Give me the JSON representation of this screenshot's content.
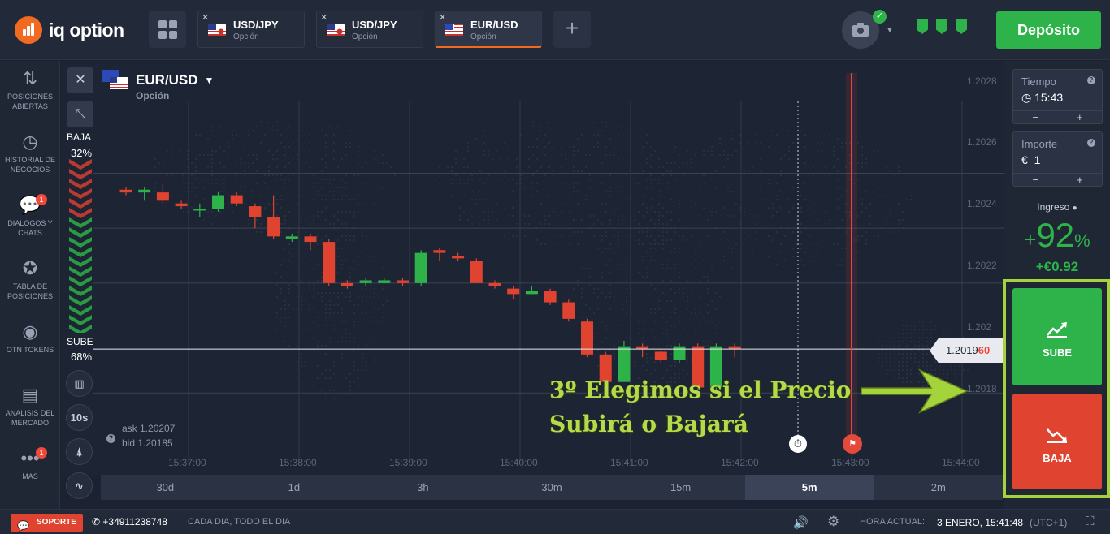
{
  "header": {
    "logo_text": "iq option",
    "tabs": [
      {
        "pair": "USD/JPY",
        "type": "Opción",
        "active": false
      },
      {
        "pair": "USD/JPY",
        "type": "Opción",
        "active": false
      },
      {
        "pair": "EUR/USD",
        "type": "Opción",
        "active": true
      }
    ],
    "add_tab": "+",
    "deposit_label": "Depósito"
  },
  "sidebar": {
    "items": [
      {
        "label": "POSICIONES ABIERTAS",
        "icon": "arrows-updown-icon"
      },
      {
        "label": "HISTORIAL DE NEGOCIOS",
        "icon": "history-icon"
      },
      {
        "label": "DIALOGOS Y CHATS",
        "icon": "chat-icon",
        "badge": "1"
      },
      {
        "label": "TABLA DE POSICIONES",
        "icon": "medal-icon"
      },
      {
        "label": "OTN TOKENS",
        "icon": "token-icon"
      },
      {
        "label": "ANALISIS DEL MERCADO",
        "icon": "news-icon"
      },
      {
        "label": "MAS",
        "icon": "more-icon",
        "badge": "1"
      }
    ]
  },
  "chart": {
    "pair": "EUR/USD",
    "type": "Opción",
    "down_label": "BAJA",
    "down_pct": "32%",
    "up_label": "SUBE",
    "up_pct": "68%",
    "ask": "ask 1.20207",
    "bid": "bid 1.20185",
    "interval_btn": "10s",
    "current_price_main": "1.2019",
    "current_price_tail": "60",
    "annotation_line1": "3º Elegimos si el Precio",
    "annotation_line2": "Subirá o Bajará"
  },
  "chart_data": {
    "type": "candlestick",
    "y_ticks": [
      "1.2026",
      "1.2024",
      "1.2022",
      "1.202",
      "1.2018"
    ],
    "x_ticks": [
      "15:37:00",
      "15:38:00",
      "15:39:00",
      "15:40:00",
      "15:41:00",
      "15:42:00",
      "15:43:00",
      "15:44:00"
    ],
    "ylim": [
      1.20165,
      1.20295
    ],
    "current_price": 1.20196,
    "expiry_time": "15:43:00",
    "candles": [
      {
        "o": 1.20254,
        "c": 1.20253,
        "h": 1.20255,
        "l": 1.20252
      },
      {
        "o": 1.20253,
        "c": 1.20254,
        "h": 1.20255,
        "l": 1.2025
      },
      {
        "o": 1.20253,
        "c": 1.2025,
        "h": 1.20256,
        "l": 1.20249
      },
      {
        "o": 1.20249,
        "c": 1.20248,
        "h": 1.2025,
        "l": 1.20247
      },
      {
        "o": 1.20247,
        "c": 1.20247,
        "h": 1.20249,
        "l": 1.20244
      },
      {
        "o": 1.20247,
        "c": 1.20252,
        "h": 1.20253,
        "l": 1.20246
      },
      {
        "o": 1.20252,
        "c": 1.20249,
        "h": 1.20253,
        "l": 1.20248
      },
      {
        "o": 1.20248,
        "c": 1.20244,
        "h": 1.20249,
        "l": 1.2024
      },
      {
        "o": 1.20244,
        "c": 1.20237,
        "h": 1.20252,
        "l": 1.20236
      },
      {
        "o": 1.20236,
        "c": 1.20237,
        "h": 1.20238,
        "l": 1.20235
      },
      {
        "o": 1.20237,
        "c": 1.20235,
        "h": 1.20238,
        "l": 1.20232
      },
      {
        "o": 1.20235,
        "c": 1.2022,
        "h": 1.20236,
        "l": 1.20219
      },
      {
        "o": 1.2022,
        "c": 1.20219,
        "h": 1.20221,
        "l": 1.20218
      },
      {
        "o": 1.2022,
        "c": 1.20221,
        "h": 1.20222,
        "l": 1.20219
      },
      {
        "o": 1.2022,
        "c": 1.20221,
        "h": 1.20222,
        "l": 1.2022
      },
      {
        "o": 1.20221,
        "c": 1.2022,
        "h": 1.20222,
        "l": 1.20219
      },
      {
        "o": 1.2022,
        "c": 1.20231,
        "h": 1.20232,
        "l": 1.20219
      },
      {
        "o": 1.20232,
        "c": 1.20231,
        "h": 1.20233,
        "l": 1.20228
      },
      {
        "o": 1.2023,
        "c": 1.20229,
        "h": 1.20231,
        "l": 1.20228
      },
      {
        "o": 1.20228,
        "c": 1.2022,
        "h": 1.20229,
        "l": 1.2022
      },
      {
        "o": 1.2022,
        "c": 1.20219,
        "h": 1.20221,
        "l": 1.20218
      },
      {
        "o": 1.20218,
        "c": 1.20216,
        "h": 1.20219,
        "l": 1.20214
      },
      {
        "o": 1.20216,
        "c": 1.20217,
        "h": 1.20219,
        "l": 1.20216
      },
      {
        "o": 1.20217,
        "c": 1.20213,
        "h": 1.20218,
        "l": 1.20212
      },
      {
        "o": 1.20213,
        "c": 1.20207,
        "h": 1.20214,
        "l": 1.20206
      },
      {
        "o": 1.20206,
        "c": 1.20194,
        "h": 1.20207,
        "l": 1.20193
      },
      {
        "o": 1.20194,
        "c": 1.20184,
        "h": 1.20195,
        "l": 1.20183
      },
      {
        "o": 1.20184,
        "c": 1.20197,
        "h": 1.20199,
        "l": 1.20184
      },
      {
        "o": 1.20197,
        "c": 1.20196,
        "h": 1.20198,
        "l": 1.20193
      },
      {
        "o": 1.20195,
        "c": 1.20192,
        "h": 1.20196,
        "l": 1.20191
      },
      {
        "o": 1.20192,
        "c": 1.20197,
        "h": 1.20198,
        "l": 1.20191
      },
      {
        "o": 1.20197,
        "c": 1.20182,
        "h": 1.20198,
        "l": 1.20181
      },
      {
        "o": 1.20182,
        "c": 1.20197,
        "h": 1.20198,
        "l": 1.20181
      },
      {
        "o": 1.20197,
        "c": 1.20196,
        "h": 1.20198,
        "l": 1.20193
      }
    ]
  },
  "timeframes": {
    "items": [
      "30d",
      "1d",
      "3h",
      "30m",
      "15m",
      "5m",
      "2m"
    ],
    "active": "5m"
  },
  "trade": {
    "time_label": "Tiempo",
    "time_value": "15:43",
    "amount_label": "Importe",
    "amount_currency": "€",
    "amount_value": "1",
    "minus": "−",
    "plus": "+",
    "income_label": "Ingreso",
    "income_sign": "+",
    "income_pct": "92",
    "income_unit": "%",
    "income_amount": "+€0.92",
    "up_label": "SUBE",
    "down_label": "BAJA"
  },
  "footer": {
    "support_label": "SOPORTE",
    "phone": "+34911238748",
    "hours": "CADA DIA, TODO EL DIA",
    "clock_label": "HORA ACTUAL:",
    "clock_value": "3 ENERO, 15:41:48",
    "timezone": "(UTC+1)"
  },
  "colors": {
    "accent_orange": "#f26a21",
    "up_green": "#2db34a",
    "down_red": "#e0432f",
    "annotation_green": "#b4da4c"
  }
}
